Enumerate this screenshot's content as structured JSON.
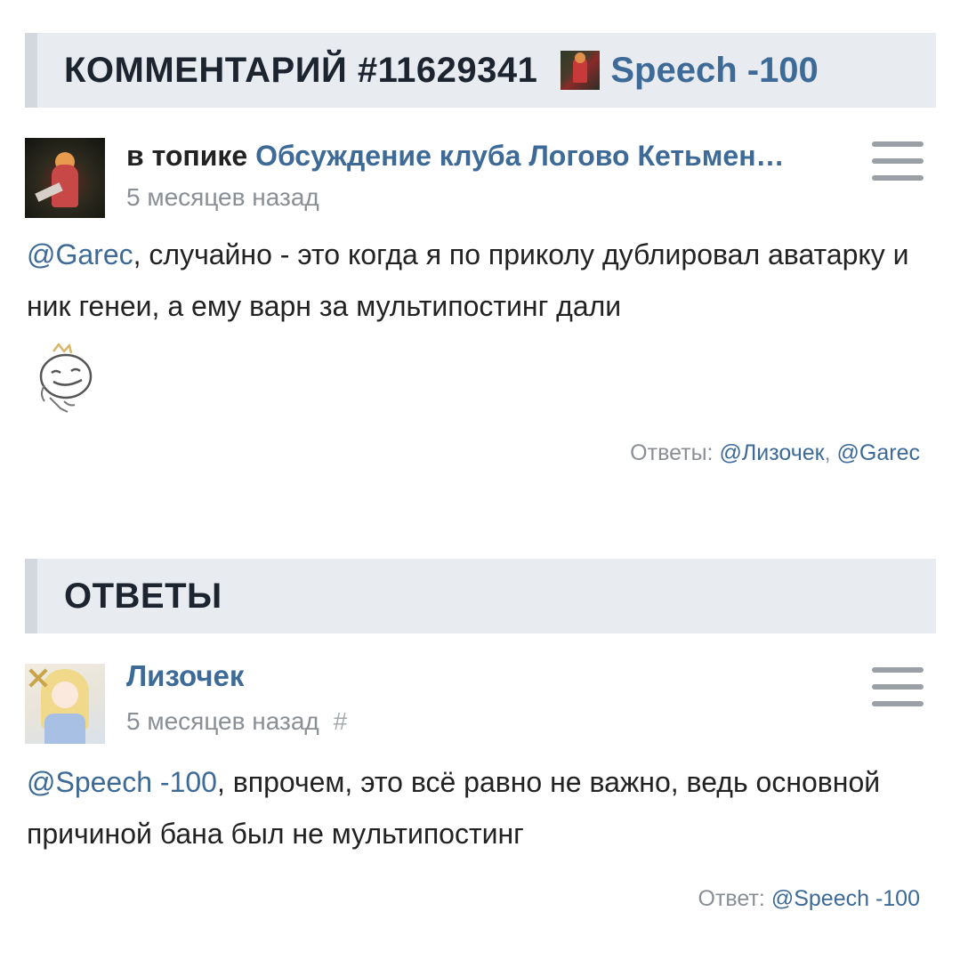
{
  "comment_header": {
    "title": "КОММЕНТАРИЙ #11629341",
    "author": "Speech -100",
    "author_avatar_icon": "user-avatar-icon"
  },
  "comment": {
    "topic_prefix": "в топике",
    "topic_name": "Обсуждение клуба Логово Кетьмен…",
    "time": "5 месяцев назад",
    "mention": "@Garec",
    "text": ", случайно - это когда я по приколу дублировал аватарку и ник генеи, а ему варн за мультипостинг дали",
    "emoticon": "smiley-emoticon-icon",
    "replies_label": "Ответы:",
    "replies": [
      "@Лизочек",
      "@Garec"
    ],
    "replies_separator": ","
  },
  "answers_header": {
    "title": "ОТВЕТЫ"
  },
  "reply": {
    "author": "Лизочек",
    "time": "5 месяцев назад",
    "hash": "#",
    "mention": "@Speech -100",
    "text": ", впрочем, это всё равно не важно, ведь основной причиной бана был не мультипостинг",
    "reply_to_label": "Ответ:",
    "reply_to": "@Speech -100"
  },
  "colors": {
    "link": "#3d6a97",
    "header_bg": "#e8ebf0",
    "muted": "#8a8f96"
  }
}
